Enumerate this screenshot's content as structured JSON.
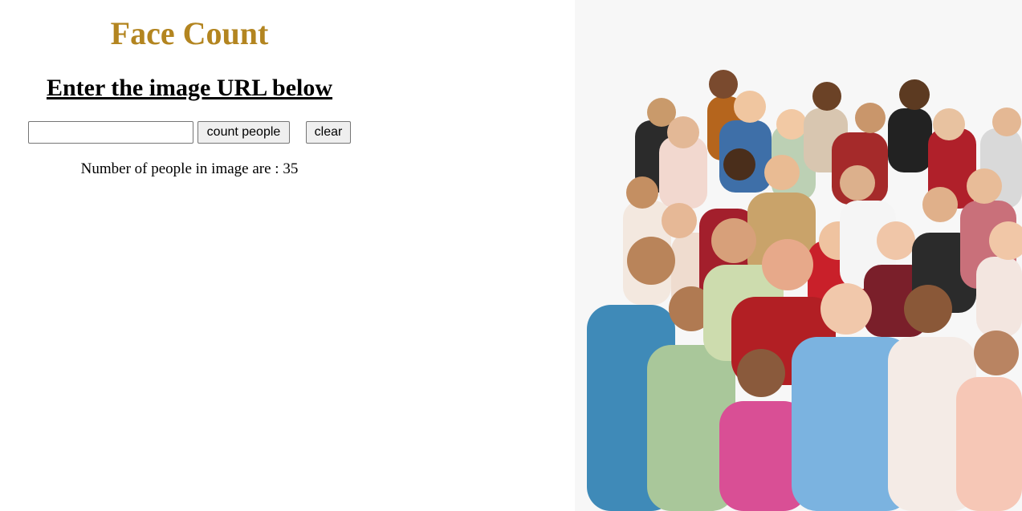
{
  "header": {
    "title": "Face Count",
    "subtitle": "Enter the image URL below",
    "title_color": "#b38520"
  },
  "form": {
    "url_value": "",
    "url_placeholder": "",
    "count_button_label": "count people",
    "clear_button_label": "clear"
  },
  "result": {
    "label": "Number of people in image are :",
    "count": 35,
    "text": "Number of people in image are : 35"
  },
  "image": {
    "description_icon": "group-photo-icon"
  },
  "colors": {
    "background": "#ffffff",
    "title": "#b38520",
    "button_bg": "#efefef"
  }
}
